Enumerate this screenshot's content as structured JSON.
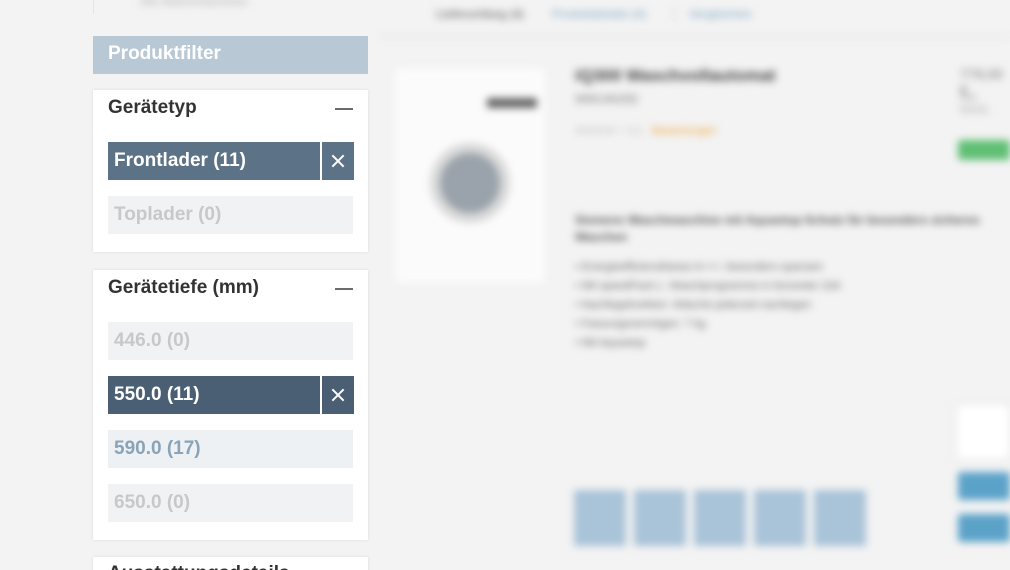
{
  "background": {
    "top_left_text": "Alle Waschmaschinen",
    "top_tabs": [
      "Lieferumfang (4)",
      "Produktdetails (4)",
      "Vergleichen"
    ],
    "product": {
      "title": "iQ300 Waschvollautomat",
      "subtitle": "WM14N292",
      "rating": "★★★★☆ 4,1",
      "rating_link": "Bewertungen",
      "price": "779,00 €",
      "price_note": "inkl. MwSt.",
      "description": "Siemens Waschmaschine mit Aquastop-Schutz für besonders sicheres Waschen",
      "bullets": [
        "Energieeffizienzklasse A+++: besonders sparsam",
        "Mit speedPack L: Waschprogramme in kürzester Zeit",
        "Nachlegefunktion: Wäsche jederzeit nachlegen",
        "Fassungsvermögen: 7 kg",
        "Mit Aquastop"
      ]
    }
  },
  "sidebar": {
    "header": "Produktfilter",
    "sections": [
      {
        "title": "Gerätetyp",
        "options": [
          {
            "label": "Frontlader (11)",
            "state": "selected"
          },
          {
            "label": "Toplader (0)",
            "state": "disabled"
          }
        ]
      },
      {
        "title": "Gerätetiefe (mm)",
        "options": [
          {
            "label": "446.0 (0)",
            "state": "disabled"
          },
          {
            "label": "550.0 (11)",
            "state": "selected"
          },
          {
            "label": "590.0 (17)",
            "state": "available"
          },
          {
            "label": "650.0 (0)",
            "state": "disabled"
          }
        ]
      }
    ],
    "next_section_title": "Ausstattungsdetails"
  },
  "colors": {
    "header_bg": "#b8c8d4",
    "selected_bg": "#5c7287",
    "selected_dark_bg": "#4a5f73",
    "available_text": "#8aa3b7",
    "disabled_text": "#c6c8ca"
  }
}
